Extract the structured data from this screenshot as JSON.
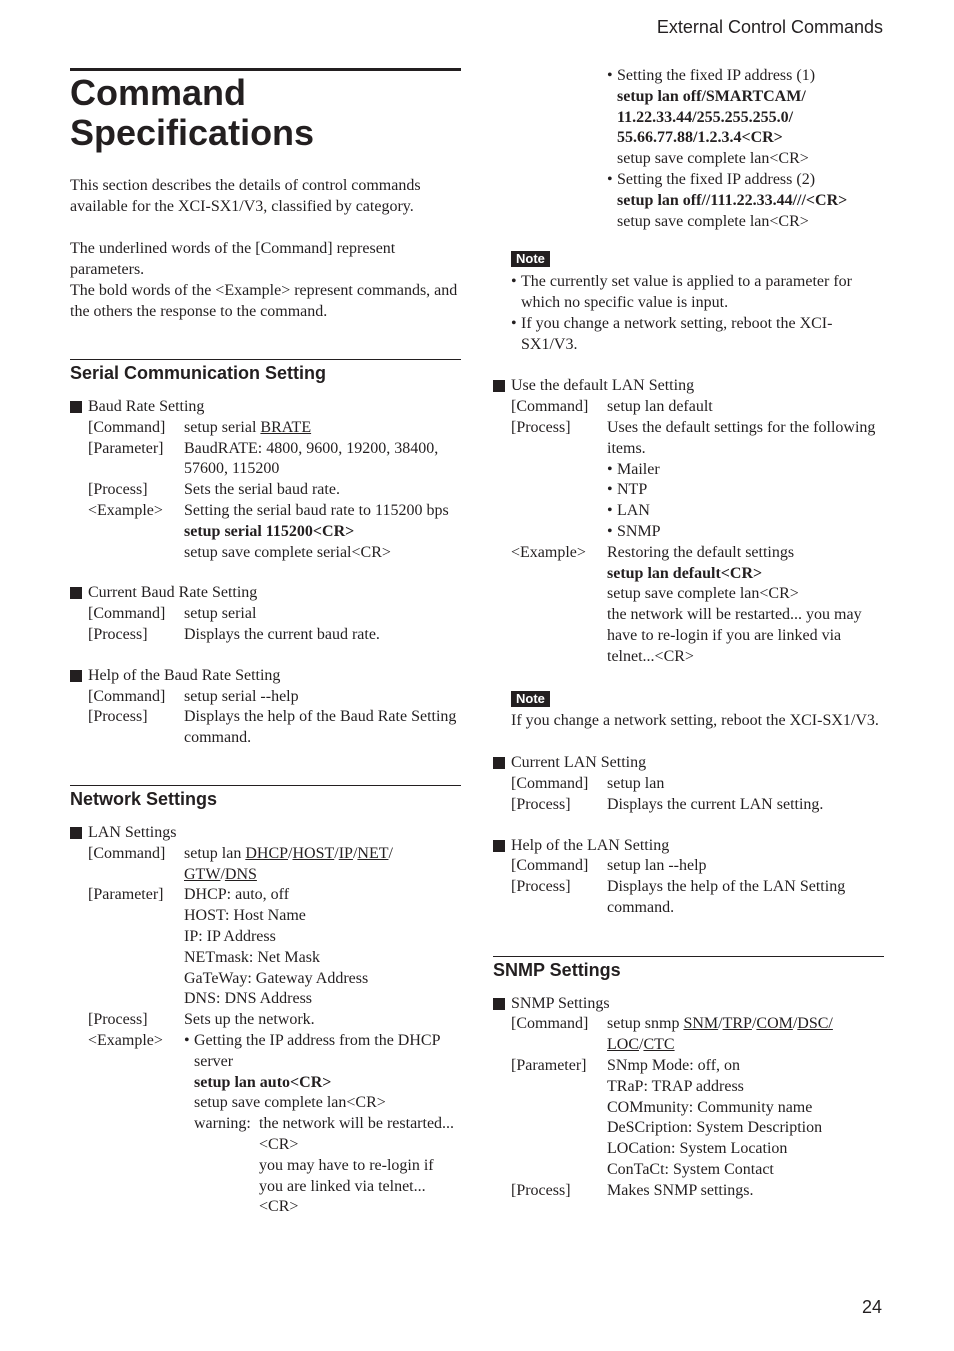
{
  "header": {
    "section_title": "External Control Commands",
    "page_number": "24"
  },
  "page_title": [
    "Command",
    "Specifications"
  ],
  "intro": {
    "p1": "This section describes the details of control commands available for the XCI-SX1/V3, classified by category.",
    "p2a": "The underlined words of the [Command] represent parameters.",
    "p2b": "The bold words of the <Example> represent commands, and the others the response to the command."
  },
  "labels": {
    "command": "[Command]",
    "parameter": "[Parameter]",
    "process": "[Process]",
    "example": "<Example>",
    "note": "Note"
  },
  "serial": {
    "heading": "Serial Communication Setting",
    "baud": {
      "title": "Baud Rate Setting",
      "cmd_prefix": "setup serial ",
      "cmd_param": "BRATE",
      "param": "BaudRATE: 4800, 9600, 19200, 38400, 57600, 115200",
      "process": "Sets the serial baud rate.",
      "example_desc": "Setting the serial baud rate to 115200 bps",
      "example_cmd": "setup serial 115200<CR>",
      "example_resp": "setup save complete serial<CR>"
    },
    "current": {
      "title": "Current Baud Rate Setting",
      "cmd": "setup serial",
      "process": "Displays the current baud rate."
    },
    "help": {
      "title": "Help of the Baud Rate Setting",
      "cmd": "setup serial --help",
      "process": "Displays the help of the Baud Rate Setting command."
    }
  },
  "network": {
    "heading": "Network Settings",
    "lan": {
      "title": "LAN Settings",
      "cmd_prefix": "setup lan ",
      "cmd_params": [
        "DHCP",
        "HOST",
        "IP",
        "NET",
        "GTW",
        "DNS"
      ],
      "params": [
        "DHCP: auto, off",
        "HOST: Host Name",
        "IP: IP Address",
        "NETmask: Net Mask",
        "GaTeWay: Gateway Address",
        "DNS: DNS Address"
      ],
      "process": "Sets up the network.",
      "ex1_desc": "Getting the IP address from the DHCP server",
      "ex1_cmd": "setup lan auto<CR>",
      "ex1_resp": "setup save complete lan<CR>",
      "ex1_warn_label": "warning:",
      "ex1_warn_lines": [
        "the network will be restarted...<CR>",
        "you may have to re-login if you are linked via telnet...<CR>"
      ],
      "ex2_desc": "Setting the fixed IP address (1)",
      "ex2_cmd": "setup lan off/SMARTCAM/ 11.22.33.44/255.255.255.0/ 55.66.77.88/1.2.3.4<CR>",
      "ex2_resp": "setup save complete lan<CR>",
      "ex3_desc": "Setting the fixed IP address (2)",
      "ex3_cmd": "setup lan off//111.22.33.44///<CR>",
      "ex3_resp": "setup save complete lan<CR>"
    },
    "note1": [
      "The currently set value is applied to a parameter for which no specific value is input.",
      "If you change a network setting, reboot the XCI-SX1/V3."
    ],
    "default": {
      "title": "Use the default LAN Setting",
      "cmd": "setup lan default",
      "process": "Uses the default settings for the following items.",
      "items": [
        "Mailer",
        "NTP",
        "LAN",
        "SNMP"
      ],
      "example_desc": "Restoring the default settings",
      "example_cmd": "setup lan default<CR>",
      "example_resp1": "setup save complete lan<CR>",
      "example_resp2": "the network will be restarted... you may have to re-login if you are linked via telnet...<CR>"
    },
    "note2": "If you change a network setting, reboot the XCI-SX1/V3.",
    "current": {
      "title": "Current LAN Setting",
      "cmd": "setup lan",
      "process": "Displays the current LAN setting."
    },
    "help": {
      "title": "Help of the LAN Setting",
      "cmd": "setup lan --help",
      "process": "Displays the help of the LAN Setting command."
    }
  },
  "snmp": {
    "heading": "SNMP Settings",
    "item": {
      "title": "SNMP Settings",
      "cmd_prefix": "setup snmp ",
      "cmd_params": [
        "SNM",
        "TRP",
        "COM",
        "DSC",
        "LOC",
        "CTC"
      ],
      "params": [
        "SNmp Mode: off, on",
        "TRaP: TRAP address",
        "COMmunity: Community name",
        "DeSCription: System Description",
        "LOCation: System Location",
        "ConTaCt: System Contact"
      ],
      "process": "Makes SNMP settings."
    }
  }
}
